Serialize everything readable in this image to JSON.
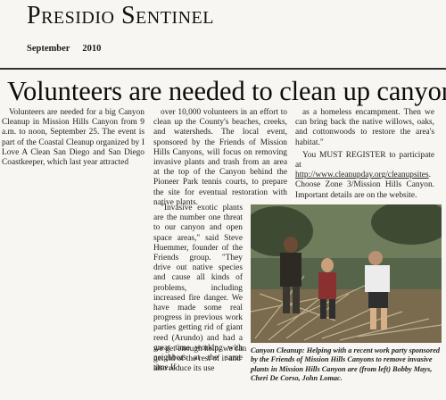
{
  "masthead": "Presidio Sentinel",
  "issue": {
    "month": "September",
    "year": "2010"
  },
  "article": {
    "headline": "Volunteers are needed to clean up canyons",
    "col1": "Volunteers are needed for a big Canyon Cleanup in Mission Hills Canyon from 9 a.m. to noon, September 25. The event is part of the Coastal Cleanup organized by I Love A Clean San Diego and San Diego Coastkeeper, which last year attracted",
    "col2": "over 10,000 volunteers in an effort to clean up the County's beaches, creeks, and watersheds. The local event, sponsored by the Friends of Mission Hills Canyons, will focus on removing invasive plants and trash from an area at the top of the Canyon behind the Pioneer Park tennis courts, to prepare the site for eventual restoration with native plants.",
    "quote": "\"Invasive exotic plants are the number one threat to our canyon and open space areas,\" said Steve Huemmer, founder of the Friends group. \"They drive out native species and cause all kinds of problems, including increased fire danger. We have made some real progress in previous work parties getting rid of giant reed (Arundo) and had a great time working with neighbors at the same time.If",
    "quote_cont": "we get enough help, we can get rid of the rest of it and also reduce its use",
    "col3_p1": "as a homeless encampment. Then we can bring back the native willows, oaks, and cottonwoods to restore the area's habitat.\"",
    "col3_p2_before": "You MUST REGISTER to participate at ",
    "col3_link": "http://www.cleanupday.org/cleanupsites",
    "col3_p2_after": ". Choose Zone 3/Mission Hills Canyon. Important details are on the website.",
    "caption": "Canyon Cleanup: Helping with a recent work party sponsored by the Friends of Mission Hills Canyons to remove invasive plants in Mission Hills Canyon are (from left) Bobby Mays, Cheri De Corso, John Lomac."
  },
  "colors": {
    "text": "#1a1a1a",
    "paper": "#f7f6f2",
    "rule": "#333333"
  }
}
